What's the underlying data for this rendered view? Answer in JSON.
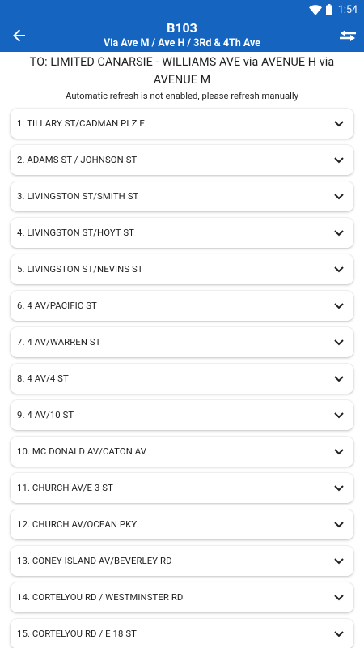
{
  "status_bar": {
    "time": "1:54"
  },
  "header": {
    "route": "B103",
    "via": "Via Ave M / Ave H / 3Rd & 4Th Ave"
  },
  "destination": "TO: LIMITED CANARSIE - WILLIAMS AVE via AVENUE H via AVENUE M",
  "refresh_notice": "Automatic refresh is not enabled, please refresh manually",
  "stops": [
    {
      "label": "1. TILLARY ST/CADMAN PLZ E"
    },
    {
      "label": "2. ADAMS ST / JOHNSON ST"
    },
    {
      "label": "3. LIVINGSTON ST/SMITH ST"
    },
    {
      "label": "4. LIVINGSTON ST/HOYT ST"
    },
    {
      "label": "5. LIVINGSTON ST/NEVINS ST"
    },
    {
      "label": "6. 4 AV/PACIFIC ST"
    },
    {
      "label": "7. 4 AV/WARREN ST"
    },
    {
      "label": "8. 4 AV/4 ST"
    },
    {
      "label": "9. 4 AV/10 ST"
    },
    {
      "label": "10. MC DONALD AV/CATON AV"
    },
    {
      "label": "11. CHURCH AV/E 3 ST"
    },
    {
      "label": "12. CHURCH AV/OCEAN PKY"
    },
    {
      "label": "13. CONEY ISLAND AV/BEVERLEY RD"
    },
    {
      "label": "14. CORTELYOU RD / WESTMINSTER RD"
    },
    {
      "label": "15. CORTELYOU RD / E 18 ST"
    }
  ],
  "colors": {
    "primary": "#1565c0",
    "text": "#212121"
  },
  "icons": {
    "back": "arrow-back-icon",
    "swap": "swap-direction-icon",
    "expand": "chevron-down-icon"
  }
}
